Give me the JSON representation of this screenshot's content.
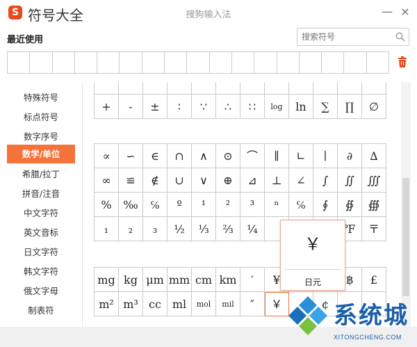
{
  "window": {
    "app_title": "符号大全",
    "center_title": "搜狗输入法",
    "logo_glyph": "S",
    "min_glyph": "—",
    "close_glyph": "×"
  },
  "recent": {
    "label": "最近使用",
    "cell_count": 17
  },
  "search": {
    "placeholder": "搜索符号"
  },
  "sidebar": {
    "active_index": 3,
    "items": [
      {
        "label": "特殊符号"
      },
      {
        "label": "标点符号"
      },
      {
        "label": "数字序号"
      },
      {
        "label": "数学/单位"
      },
      {
        "label": "希腊/拉丁"
      },
      {
        "label": "拼音/注音"
      },
      {
        "label": "中文字符"
      },
      {
        "label": "英文音标"
      },
      {
        "label": "日文字符"
      },
      {
        "label": "韩文字符"
      },
      {
        "label": "俄文字母"
      },
      {
        "label": "制表符"
      }
    ]
  },
  "groups": [
    {
      "rows": [
        [
          "",
          "",
          "",
          "",
          "",
          "",
          "",
          "",
          "",
          "",
          "",
          ""
        ],
        [
          "+",
          "-",
          "±",
          "∶",
          "∵",
          "∴",
          "∷",
          "log",
          "ln",
          "∑",
          "∏",
          "∅"
        ]
      ]
    },
    {
      "rows": [
        [
          "∝",
          "∽",
          "∈",
          "∩",
          "∧",
          "⊙",
          "⌒",
          "∥",
          "∟",
          "∣",
          "∂",
          "∆"
        ],
        [
          "∞",
          "≌",
          "∉",
          "∪",
          "∨",
          "⊕",
          "⊿",
          "⊥",
          "∠",
          "∫",
          "∬",
          "∭"
        ],
        [
          "%",
          "‰",
          "℅",
          "º",
          "¹",
          "²",
          "³",
          "ⁿ",
          "℅",
          "∮",
          "∯",
          "∰"
        ],
        [
          "₁",
          "₂",
          "₃",
          "½",
          "⅓",
          "⅔",
          "¼",
          "",
          "",
          "",
          "℉",
          "〒"
        ]
      ]
    },
    {
      "rows": [
        [
          "mg",
          "kg",
          "μm",
          "mm",
          "cm",
          "km",
          "′",
          "¥",
          "",
          "",
          "฿",
          "£"
        ],
        [
          "m²",
          "m³",
          "cc",
          "ml",
          "mol",
          "mil",
          "″",
          "￥",
          "",
          "¢",
          "",
          ""
        ]
      ]
    }
  ],
  "popup": {
    "symbol": "￥",
    "name": "日元"
  },
  "watermark": {
    "brand": "系统城",
    "url": "XITONGCHENG.COM"
  }
}
